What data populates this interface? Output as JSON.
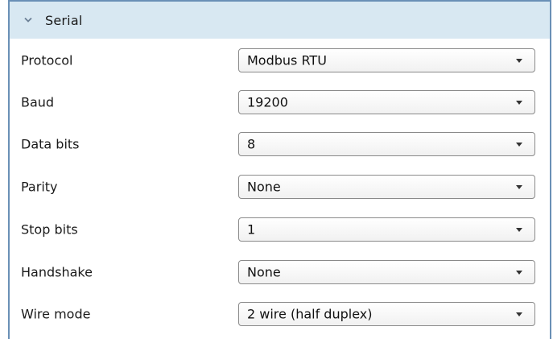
{
  "section": {
    "title": "Serial",
    "icon": "chevron-down-icon"
  },
  "fields": [
    {
      "label": "Protocol",
      "value": "Modbus RTU"
    },
    {
      "label": "Baud",
      "value": "19200"
    },
    {
      "label": "Data bits",
      "value": "8"
    },
    {
      "label": "Parity",
      "value": "None"
    },
    {
      "label": "Stop bits",
      "value": "1"
    },
    {
      "label": "Handshake",
      "value": "None"
    },
    {
      "label": "Wire mode",
      "value": "2 wire (half duplex)"
    }
  ],
  "colors": {
    "header_bg": "#d8e8f2",
    "frame_border": "#6a90b6"
  }
}
